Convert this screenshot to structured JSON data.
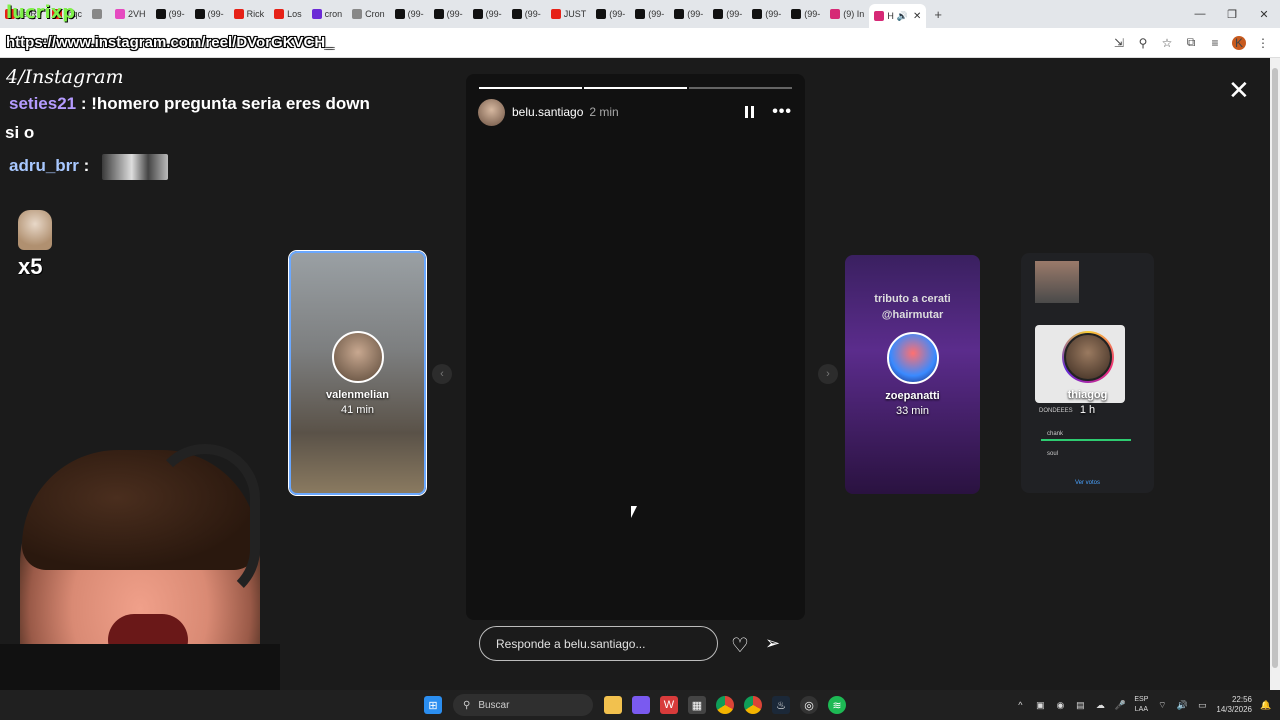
{
  "browser": {
    "tabs": [
      {
        "label": "La Re",
        "fav_color": "#e62117"
      },
      {
        "label": "mqc",
        "fav_color": "#e62117"
      },
      {
        "label": "",
        "fav_color": "#888888"
      },
      {
        "label": "2VH",
        "fav_color": "#e54ac0"
      },
      {
        "label": "(99-",
        "fav_color": "#111111"
      },
      {
        "label": "(99-",
        "fav_color": "#111111"
      },
      {
        "label": "Rick",
        "fav_color": "#e62117"
      },
      {
        "label": "Los",
        "fav_color": "#e62117"
      },
      {
        "label": "cron",
        "fav_color": "#6b2ad6"
      },
      {
        "label": "Cron",
        "fav_color": "#888888"
      },
      {
        "label": "(99-",
        "fav_color": "#111111"
      },
      {
        "label": "(99-",
        "fav_color": "#111111"
      },
      {
        "label": "(99-",
        "fav_color": "#111111"
      },
      {
        "label": "(99-",
        "fav_color": "#111111"
      },
      {
        "label": "JUST",
        "fav_color": "#e62117"
      },
      {
        "label": "(99-",
        "fav_color": "#111111"
      },
      {
        "label": "(99-",
        "fav_color": "#111111"
      },
      {
        "label": "(99-",
        "fav_color": "#111111"
      },
      {
        "label": "(99-",
        "fav_color": "#111111"
      },
      {
        "label": "(99-",
        "fav_color": "#111111"
      },
      {
        "label": "(99-",
        "fav_color": "#111111"
      },
      {
        "label": "(9) In",
        "fav_color": "#d62976"
      }
    ],
    "active_tab": {
      "label": "H"
    },
    "url": "https://www.instagram.com/reel/DVorGKVCH_"
  },
  "stream": {
    "streamer": "lucrixp",
    "ig_logo": "4/Instagram",
    "chat": [
      {
        "user": "seties21",
        "message": " : !homero pregunta seria eres down"
      },
      {
        "continuation": "si o"
      },
      {
        "user": "adru_brr",
        "message": " : "
      }
    ],
    "emote_count": "x5"
  },
  "story": {
    "username": "belu.santiago",
    "time": "2 min",
    "reply_placeholder": "Responde a belu.santiago..."
  },
  "previews": [
    {
      "username": "valenmelian",
      "time": "41 min"
    },
    {
      "username": "zoepanatti",
      "time": "33 min",
      "caption_line1": "tributo a cerati",
      "caption_line2": "@hairmutar"
    },
    {
      "username": "thiagog",
      "time": "1 h",
      "poll_title": "DONDEEES",
      "poll_opt1": "chank",
      "poll_opt2": "soul",
      "poll_link": "Ver votos"
    }
  ],
  "taskbar": {
    "search_label": "Buscar",
    "lang_line1": "ESP",
    "lang_line2": "LAA",
    "time": "22:56",
    "date": "14/3/2026"
  },
  "colors": {
    "accent_blue": "#6aa8ff",
    "streamer_green": "#7ff04a"
  }
}
